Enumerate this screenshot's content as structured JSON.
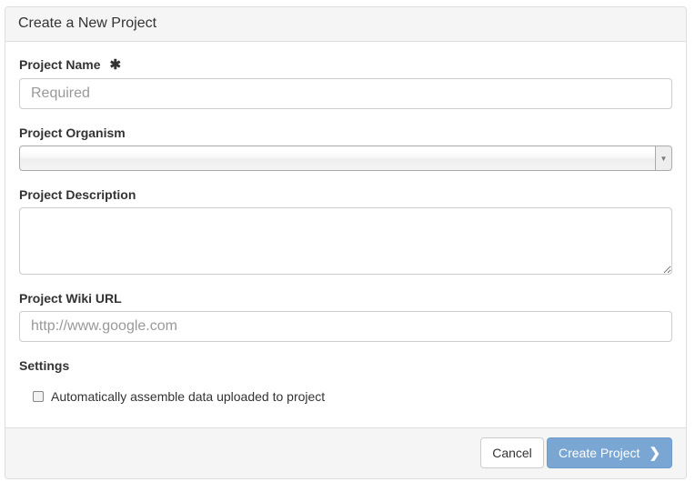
{
  "panel": {
    "title": "Create a New Project"
  },
  "form": {
    "name": {
      "label": "Project Name",
      "placeholder": "Required",
      "required_icon": "asterisk-icon",
      "required_glyph": "✱"
    },
    "organism": {
      "label": "Project Organism",
      "value": "",
      "arrow_glyph": "▼"
    },
    "description": {
      "label": "Project Description"
    },
    "wiki": {
      "label": "Project Wiki URL",
      "placeholder": "http://www.google.com"
    },
    "settings": {
      "label": "Settings",
      "auto_assemble": {
        "label": "Automatically assemble data uploaded to project",
        "checked": false
      }
    }
  },
  "footer": {
    "cancel_label": "Cancel",
    "create_label": "Create Project",
    "create_icon": "chevron-right-icon",
    "create_glyph": "❯"
  },
  "colors": {
    "primary": "#7aa6d3",
    "heading_bg": "#f5f5f5",
    "border": "#dddddd"
  }
}
